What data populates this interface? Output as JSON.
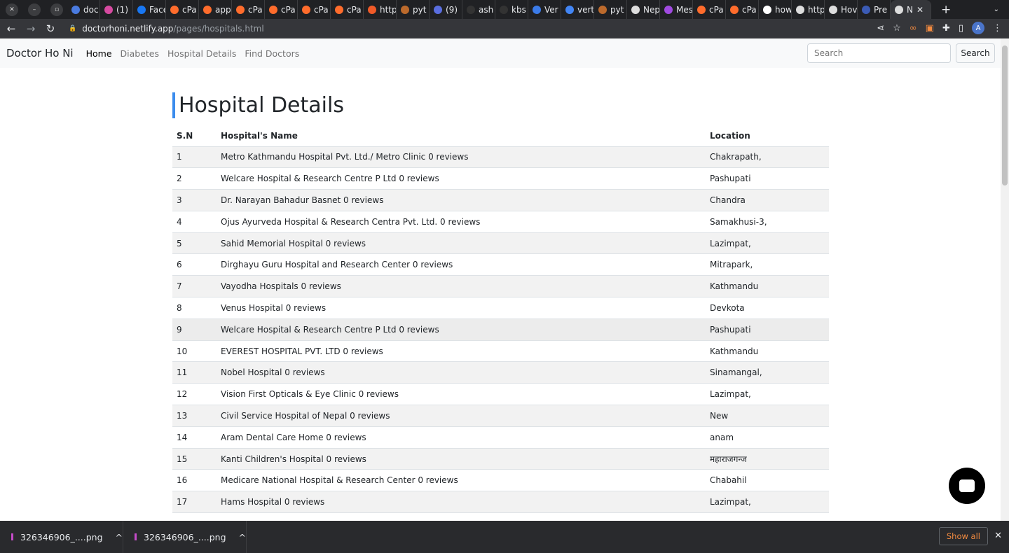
{
  "browser": {
    "tabs": [
      {
        "label": "doc",
        "color": "#4a7be0"
      },
      {
        "label": "(1)",
        "color": "#d64aa0"
      },
      {
        "label": "Face",
        "color": "#1877f2"
      },
      {
        "label": "cPa",
        "color": "#ff6c2c"
      },
      {
        "label": "app",
        "color": "#ff6c2c"
      },
      {
        "label": "cPa",
        "color": "#ff6c2c"
      },
      {
        "label": "cPa",
        "color": "#ff6c2c"
      },
      {
        "label": "cPa",
        "color": "#ff6c2c"
      },
      {
        "label": "cPa",
        "color": "#ff6c2c"
      },
      {
        "label": "http",
        "color": "#f05a28"
      },
      {
        "label": "pyt",
        "color": "#bc6a2c"
      },
      {
        "label": "(9)",
        "color": "#5a6ee0"
      },
      {
        "label": "ash",
        "color": "#333"
      },
      {
        "label": "kbs",
        "color": "#333"
      },
      {
        "label": "Ver",
        "color": "#3b7be8"
      },
      {
        "label": "vert",
        "color": "#4285f4"
      },
      {
        "label": "pyt",
        "color": "#bc6a2c"
      },
      {
        "label": "Nep",
        "color": "#ddd"
      },
      {
        "label": "Mes",
        "color": "#a04ae0"
      },
      {
        "label": "cPa",
        "color": "#ff6c2c"
      },
      {
        "label": "cPa",
        "color": "#ff6c2c"
      },
      {
        "label": "how",
        "color": "#fff"
      },
      {
        "label": "http",
        "color": "#ddd"
      },
      {
        "label": "Hov",
        "color": "#ddd"
      },
      {
        "label": "Pre",
        "color": "#3b5bb5"
      }
    ],
    "active_tab": "N",
    "url_host": "doctorhoni.netlify.app",
    "url_path": "/pages/hospitals.html",
    "avatar": "A"
  },
  "navbar": {
    "brand": "Doctor Ho Ni",
    "links": [
      "Home",
      "Diabetes",
      "Hospital Details",
      "Find Doctors"
    ],
    "search_placeholder": "Search",
    "search_button": "Search"
  },
  "page": {
    "title": "Hospital Details",
    "columns": [
      "S.N",
      "Hospital's Name",
      "Location"
    ],
    "rows": [
      [
        "1",
        "Metro Kathmandu Hospital Pvt. Ltd./ Metro Clinic 0 reviews",
        "Chakrapath,"
      ],
      [
        "2",
        "Welcare Hospital & Research Centre P Ltd 0 reviews",
        "Pashupati"
      ],
      [
        "3",
        "Dr. Narayan Bahadur Basnet 0 reviews",
        "Chandra"
      ],
      [
        "4",
        "Ojus Ayurveda Hospital & Research Centra Pvt. Ltd. 0 reviews",
        "Samakhusi-3,"
      ],
      [
        "5",
        "Sahid Memorial Hospital 0 reviews",
        "Lazimpat,"
      ],
      [
        "6",
        "Dirghayu Guru Hospital and Research Center 0 reviews",
        "Mitrapark,"
      ],
      [
        "7",
        "Vayodha Hospitals 0 reviews",
        "Kathmandu"
      ],
      [
        "8",
        "Venus Hospital 0 reviews",
        "Devkota"
      ],
      [
        "9",
        "Welcare Hospital & Research Centre P Ltd 0 reviews",
        "Pashupati"
      ],
      [
        "10",
        "EVEREST HOSPITAL PVT. LTD 0 reviews",
        "Kathmandu"
      ],
      [
        "11",
        "Nobel Hospital 0 reviews",
        "Sinamangal,"
      ],
      [
        "12",
        "Vision First Opticals & Eye Clinic 0 reviews",
        "Lazimpat,"
      ],
      [
        "13",
        "Civil Service Hospital of Nepal 0 reviews",
        "New"
      ],
      [
        "14",
        "Aram Dental Care Home 0 reviews",
        "anam"
      ],
      [
        "15",
        "Kanti Children's Hospital 0 reviews",
        "महाराजगन्ज"
      ],
      [
        "16",
        "Medicare National Hospital & Research Center 0 reviews",
        "Chabahil"
      ],
      [
        "17",
        "Hams Hospital 0 reviews",
        "Lazimpat,"
      ]
    ]
  },
  "downloads": {
    "items": [
      "326346906_....png",
      "326346906_....png"
    ],
    "show_all": "Show all"
  }
}
